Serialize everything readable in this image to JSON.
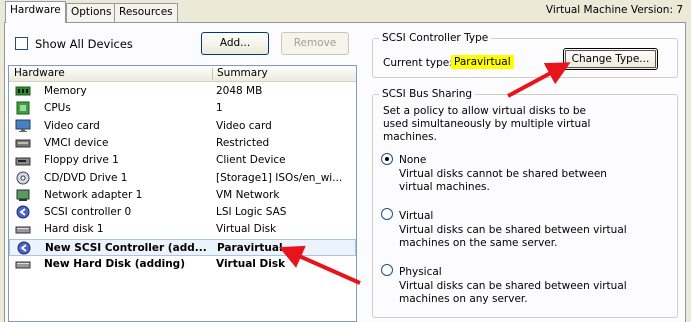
{
  "tabs": [
    {
      "label": "Hardware",
      "active": true
    },
    {
      "label": "Options",
      "active": false
    },
    {
      "label": "Resources",
      "active": false
    }
  ],
  "vm_version": "Virtual Machine Version: 7",
  "show_all_devices": {
    "label": "Show All Devices",
    "checked": false
  },
  "buttons": {
    "add": "Add...",
    "remove": "Remove",
    "change_type": "Change Type..."
  },
  "table": {
    "columns": [
      "Hardware",
      "Summary"
    ],
    "rows": [
      {
        "icon": "memory-icon",
        "name": "Memory",
        "summary": "2048 MB",
        "bold": false,
        "selected": false
      },
      {
        "icon": "cpu-icon",
        "name": "CPUs",
        "summary": "1",
        "bold": false,
        "selected": false
      },
      {
        "icon": "monitor-icon",
        "name": "Video card",
        "summary": "Video card",
        "bold": false,
        "selected": false
      },
      {
        "icon": "vmci-icon",
        "name": "VMCI device",
        "summary": "Restricted",
        "bold": false,
        "selected": false
      },
      {
        "icon": "floppy-icon",
        "name": "Floppy drive 1",
        "summary": "Client Device",
        "bold": false,
        "selected": false
      },
      {
        "icon": "cd-icon",
        "name": "CD/DVD Drive 1",
        "summary": "[Storage1] ISOs/en_wi...",
        "bold": false,
        "selected": false
      },
      {
        "icon": "network-icon",
        "name": "Network adapter 1",
        "summary": "VM Network",
        "bold": false,
        "selected": false
      },
      {
        "icon": "scsi-icon",
        "name": "SCSI controller 0",
        "summary": "LSI Logic SAS",
        "bold": false,
        "selected": false
      },
      {
        "icon": "disk-icon",
        "name": "Hard disk 1",
        "summary": "Virtual Disk",
        "bold": false,
        "selected": false
      },
      {
        "icon": "scsi-icon",
        "name": "New SCSI Controller (add...",
        "summary": "Paravirtual",
        "bold": true,
        "selected": true
      },
      {
        "icon": "disk-icon",
        "name": "New Hard Disk (adding)",
        "summary": "Virtual Disk",
        "bold": true,
        "selected": false
      }
    ]
  },
  "scsi_controller_type": {
    "legend": "SCSI Controller Type",
    "current_label": "Current type:",
    "current_value": "Paravirtual"
  },
  "scsi_bus_sharing": {
    "legend": "SCSI Bus Sharing",
    "description": "Set a policy to allow virtual disks to be used simultaneously by multiple virtual machines.",
    "options": [
      {
        "label": "None",
        "description": "Virtual disks cannot be shared between virtual machines.",
        "selected": true
      },
      {
        "label": "Virtual",
        "description": "Virtual disks can be shared between virtual machines on the same server.",
        "selected": false
      },
      {
        "label": "Physical",
        "description": "Virtual disks can be shared between virtual machines on any server.",
        "selected": false
      }
    ]
  },
  "colors": {
    "highlight": "#ffff00",
    "arrow": "#e8141b",
    "selection": "#ecf3fc"
  }
}
